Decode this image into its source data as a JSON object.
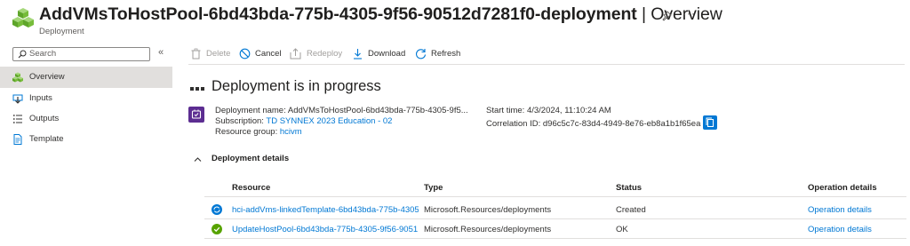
{
  "header": {
    "title": "AddVMsToHostPool-6bd43bda-775b-4305-9f56-90512d7281f0-deployment",
    "title_separator": " | ",
    "title_section": "Overview",
    "subtitle": "Deployment",
    "icons": [
      "deployment-cubes-icon",
      "pin-icon",
      "more-icon"
    ]
  },
  "sidebar": {
    "search_placeholder": "Search",
    "collapse_glyph": "«",
    "items": [
      {
        "label": "Overview",
        "icon": "overview-cubes-icon",
        "active": true
      },
      {
        "label": "Inputs",
        "icon": "inputs-icon",
        "active": false
      },
      {
        "label": "Outputs",
        "icon": "outputs-icon",
        "active": false
      },
      {
        "label": "Template",
        "icon": "template-icon",
        "active": false
      }
    ]
  },
  "toolbar": {
    "delete_label": "Delete",
    "cancel_label": "Cancel",
    "redeploy_label": "Redeploy",
    "download_label": "Download",
    "refresh_label": "Refresh"
  },
  "status": {
    "heading": "Deployment is in progress"
  },
  "info": {
    "deployment_name_label": "Deployment name:",
    "deployment_name_value": "AddVMsToHostPool-6bd43bda-775b-4305-9f5...",
    "subscription_label": "Subscription:",
    "subscription_value": "TD SYNNEX 2023 Education - 02",
    "resource_group_label": "Resource group:",
    "resource_group_value": "hcivm",
    "start_time_label": "Start time:",
    "start_time_value": "4/3/2024, 11:10:24 AM",
    "correlation_label": "Correlation ID:",
    "correlation_value": "d96c5c7c-83d4-4949-8e76-eb8a1b1f65ea"
  },
  "details": {
    "toggle_label": "Deployment details",
    "columns": [
      "Resource",
      "Type",
      "Status",
      "Operation details"
    ],
    "rows": [
      {
        "resource": "hci-addVms-linkedTemplate-6bd43bda-775b-4305",
        "type": "Microsoft.Resources/deployments",
        "status": "Created",
        "operation": "Operation details",
        "icon": "in-progress-icon"
      },
      {
        "resource": "UpdateHostPool-6bd43bda-775b-4305-9f56-9051",
        "type": "Microsoft.Resources/deployments",
        "status": "OK",
        "operation": "Operation details",
        "icon": "success-check-icon"
      }
    ]
  },
  "colors": {
    "link": "#0078d4",
    "success": "#57a300",
    "deploy_icon": "#5c2d91",
    "nav_active": "#e1dfdd"
  }
}
